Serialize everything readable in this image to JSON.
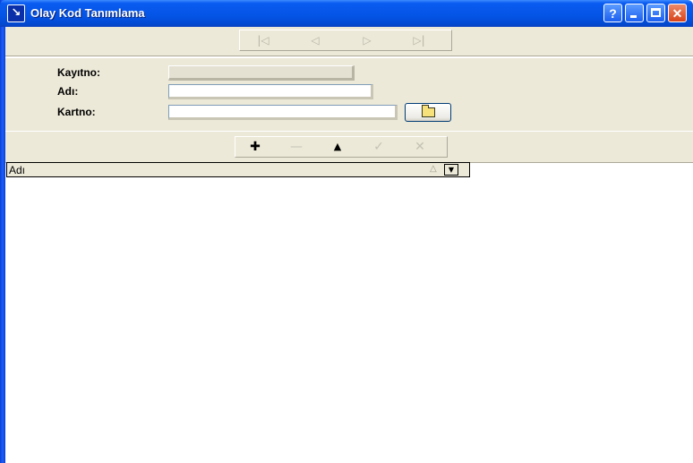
{
  "window": {
    "title": "Olay Kod Tanımlama",
    "system_icon": "↘",
    "controls": {
      "help": "?",
      "minimize": "minimize-icon",
      "maximize": "maximize-icon",
      "close": "✕"
    },
    "colors": {
      "titlebar": "#0454e6",
      "face": "#ece9d8",
      "close_button": "#d8431a"
    }
  },
  "nav_toolbar": {
    "buttons": [
      {
        "name": "first-record-icon",
        "glyph": "|◁"
      },
      {
        "name": "prior-record-icon",
        "glyph": "◁"
      },
      {
        "name": "next-record-icon",
        "glyph": "▷"
      },
      {
        "name": "last-record-icon",
        "glyph": "▷|"
      }
    ]
  },
  "form": {
    "kayitno": {
      "label": "Kayıtno:",
      "value": ""
    },
    "adi": {
      "label": "Adı:",
      "value": ""
    },
    "kartno": {
      "label": "Kartno:",
      "value": ""
    },
    "browse_icon": "folder-icon"
  },
  "edit_toolbar": {
    "buttons": [
      {
        "name": "insert-icon",
        "glyph": "✚",
        "enabled": true
      },
      {
        "name": "delete-icon",
        "glyph": "—",
        "enabled": false
      },
      {
        "name": "edit-icon",
        "glyph": "▲",
        "enabled": true
      },
      {
        "name": "post-icon",
        "glyph": "✓",
        "enabled": false
      },
      {
        "name": "cancel-icon",
        "glyph": "✕",
        "enabled": false
      }
    ]
  },
  "grid": {
    "columns": [
      "Adı"
    ],
    "sort_icon": "△",
    "dropdown_icon": "▼",
    "rows": []
  }
}
